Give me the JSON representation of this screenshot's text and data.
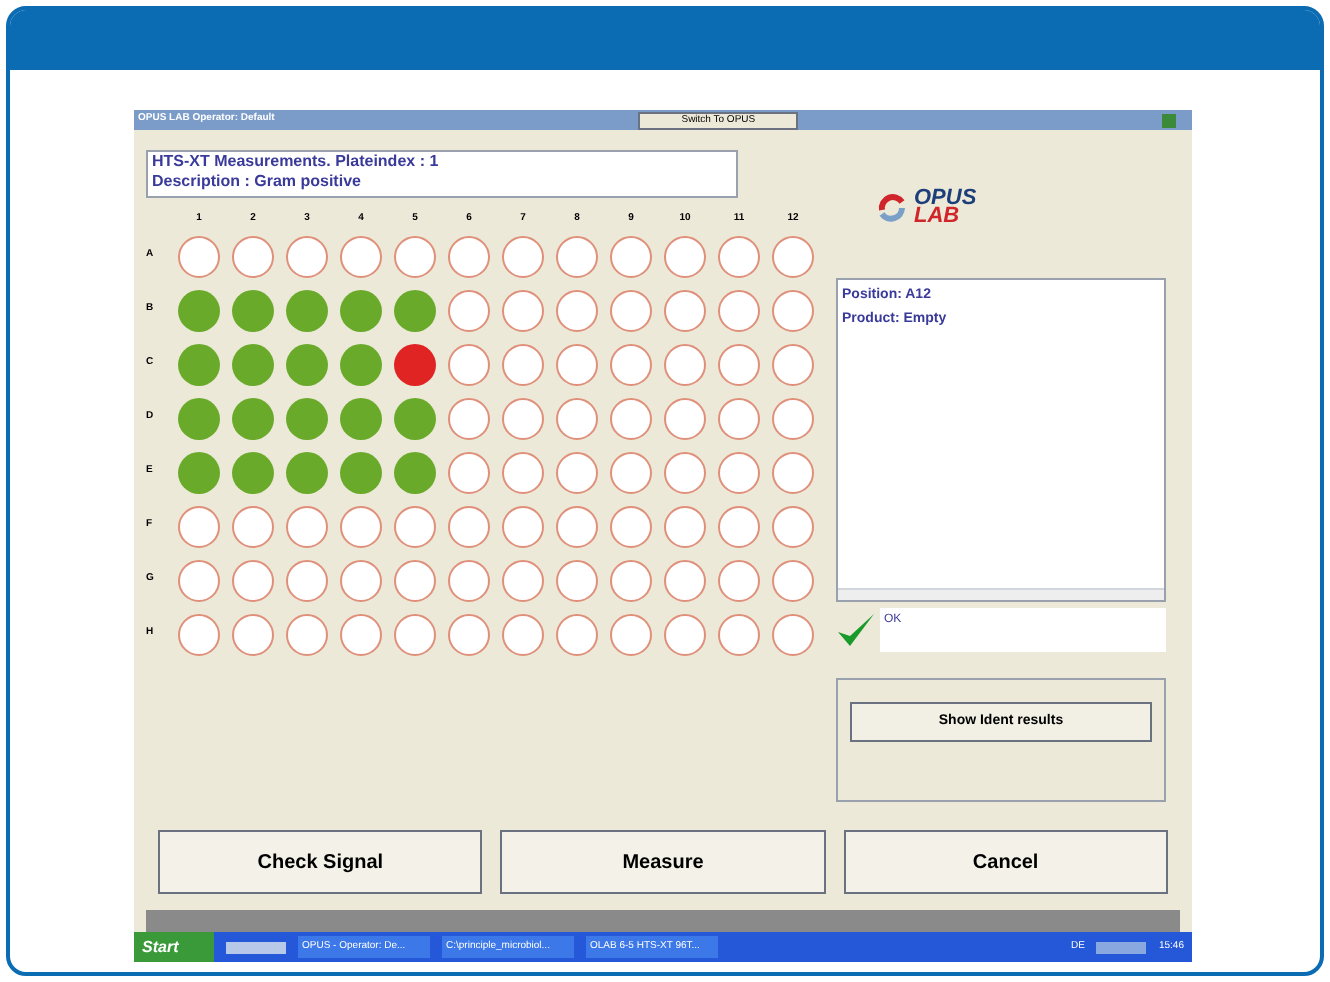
{
  "title_bar": {
    "title": "OPUS LAB Operator: Default",
    "switch_button": "Switch To OPUS"
  },
  "header": {
    "line_1": "HTS-XT Measurements. Plateindex : 1",
    "line_2": "Description : Gram positive"
  },
  "plate": {
    "columns": [
      "1",
      "2",
      "3",
      "4",
      "5",
      "6",
      "7",
      "8",
      "9",
      "10",
      "11",
      "12"
    ],
    "rows": [
      {
        "label": "A",
        "wells": [
          {
            "color": "#ffffff"
          },
          {
            "color": "#ffffff"
          },
          {
            "color": "#ffffff"
          },
          {
            "color": "#ffffff"
          },
          {
            "color": "#ffffff"
          },
          {
            "color": "#ffffff"
          },
          {
            "color": "#ffffff"
          },
          {
            "color": "#ffffff"
          },
          {
            "color": "#ffffff"
          },
          {
            "color": "#ffffff"
          },
          {
            "color": "#ffffff"
          },
          {
            "color": "#ffffff"
          }
        ]
      },
      {
        "label": "B",
        "wells": [
          {
            "color": "#6aaa2a"
          },
          {
            "color": "#6aaa2a"
          },
          {
            "color": "#6aaa2a"
          },
          {
            "color": "#6aaa2a"
          },
          {
            "color": "#6aaa2a"
          },
          {
            "color": "#ffffff"
          },
          {
            "color": "#ffffff"
          },
          {
            "color": "#ffffff"
          },
          {
            "color": "#ffffff"
          },
          {
            "color": "#ffffff"
          },
          {
            "color": "#ffffff"
          },
          {
            "color": "#ffffff"
          }
        ]
      },
      {
        "label": "C",
        "wells": [
          {
            "color": "#6aaa2a"
          },
          {
            "color": "#6aaa2a"
          },
          {
            "color": "#6aaa2a"
          },
          {
            "color": "#6aaa2a"
          },
          {
            "color": "#e02424"
          },
          {
            "color": "#ffffff"
          },
          {
            "color": "#ffffff"
          },
          {
            "color": "#ffffff"
          },
          {
            "color": "#ffffff"
          },
          {
            "color": "#ffffff"
          },
          {
            "color": "#ffffff"
          },
          {
            "color": "#ffffff"
          }
        ]
      },
      {
        "label": "D",
        "wells": [
          {
            "color": "#6aaa2a"
          },
          {
            "color": "#6aaa2a"
          },
          {
            "color": "#6aaa2a"
          },
          {
            "color": "#6aaa2a"
          },
          {
            "color": "#6aaa2a"
          },
          {
            "color": "#ffffff"
          },
          {
            "color": "#ffffff"
          },
          {
            "color": "#ffffff"
          },
          {
            "color": "#ffffff"
          },
          {
            "color": "#ffffff"
          },
          {
            "color": "#ffffff"
          },
          {
            "color": "#ffffff"
          }
        ]
      },
      {
        "label": "E",
        "wells": [
          {
            "color": "#6aaa2a"
          },
          {
            "color": "#6aaa2a"
          },
          {
            "color": "#6aaa2a"
          },
          {
            "color": "#6aaa2a"
          },
          {
            "color": "#6aaa2a"
          },
          {
            "color": "#ffffff"
          },
          {
            "color": "#ffffff"
          },
          {
            "color": "#ffffff"
          },
          {
            "color": "#ffffff"
          },
          {
            "color": "#ffffff"
          },
          {
            "color": "#ffffff"
          },
          {
            "color": "#ffffff"
          }
        ]
      },
      {
        "label": "F",
        "wells": [
          {
            "color": "#ffffff"
          },
          {
            "color": "#ffffff"
          },
          {
            "color": "#ffffff"
          },
          {
            "color": "#ffffff"
          },
          {
            "color": "#ffffff"
          },
          {
            "color": "#ffffff"
          },
          {
            "color": "#ffffff"
          },
          {
            "color": "#ffffff"
          },
          {
            "color": "#ffffff"
          },
          {
            "color": "#ffffff"
          },
          {
            "color": "#ffffff"
          },
          {
            "color": "#ffffff"
          }
        ]
      },
      {
        "label": "G",
        "wells": [
          {
            "color": "#ffffff"
          },
          {
            "color": "#ffffff"
          },
          {
            "color": "#ffffff"
          },
          {
            "color": "#ffffff"
          },
          {
            "color": "#ffffff"
          },
          {
            "color": "#ffffff"
          },
          {
            "color": "#ffffff"
          },
          {
            "color": "#ffffff"
          },
          {
            "color": "#ffffff"
          },
          {
            "color": "#ffffff"
          },
          {
            "color": "#ffffff"
          },
          {
            "color": "#ffffff"
          }
        ]
      },
      {
        "label": "H",
        "wells": [
          {
            "color": "#ffffff"
          },
          {
            "color": "#ffffff"
          },
          {
            "color": "#ffffff"
          },
          {
            "color": "#ffffff"
          },
          {
            "color": "#ffffff"
          },
          {
            "color": "#ffffff"
          },
          {
            "color": "#ffffff"
          },
          {
            "color": "#ffffff"
          },
          {
            "color": "#ffffff"
          },
          {
            "color": "#ffffff"
          },
          {
            "color": "#ffffff"
          },
          {
            "color": "#ffffff"
          }
        ]
      }
    ]
  },
  "logo": {
    "top": "OPUS",
    "bottom": "LAB"
  },
  "info": {
    "lines": [
      "Position: A12",
      "Product: Empty"
    ]
  },
  "status": {
    "text": "OK"
  },
  "show_ident_button": "Show Ident results",
  "buttons": [
    "Check Signal",
    "Measure",
    "Cancel"
  ],
  "taskbar": {
    "start": "Start",
    "tasks": [
      "OPUS - Operator: De...",
      "C:\\principle_microbiol...",
      "OLAB 6-5 HTS-XT 96T..."
    ],
    "language": "DE",
    "clock": "15:46"
  }
}
